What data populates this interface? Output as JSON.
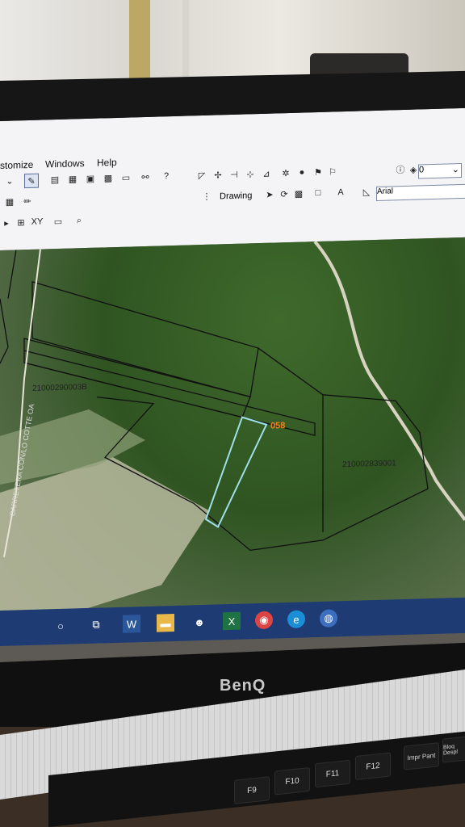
{
  "menu": {
    "customize": "stomize",
    "windows": "Windows",
    "help": "Help"
  },
  "toolbar": {
    "zoom_value": "0",
    "drawing_label": "Drawing",
    "text_tool": "A",
    "font_name": "Arial"
  },
  "map": {
    "road_label": "CARRETERA CON/LO COTTE OA",
    "parcel_top_left": "21000290003B",
    "parcel_right": "210002839001",
    "parcel_small": "058"
  },
  "taskbar": {
    "icons": [
      "search-icon",
      "task-view-icon",
      "word-icon",
      "file-explorer-icon",
      "people-icon",
      "excel-icon",
      "chrome-icon",
      "edge-icon",
      "arcgis-icon"
    ]
  },
  "monitor": {
    "brand": "BenQ"
  },
  "keyboard": {
    "keys": [
      "F9",
      "F10",
      "F11",
      "F12",
      "Impr Pant",
      "Bloq Despl"
    ]
  },
  "colors": {
    "taskbar": "#1e3c73",
    "parcel_highlight": "#9fe0ea",
    "label_orange": "#f08020"
  }
}
